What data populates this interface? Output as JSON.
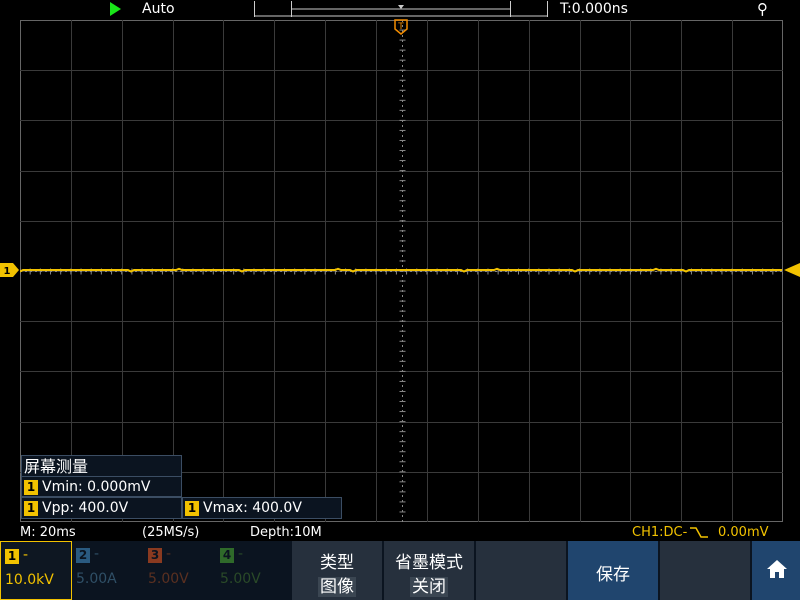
{
  "topbar": {
    "trigger_mode": "Auto",
    "trigger_time": "T:0.000ns"
  },
  "screen_measure": {
    "title": "屏幕测量",
    "vmin": "Vmin: 0.000mV",
    "vpp": "Vpp: 400.0V",
    "vmax": "Vmax: 400.0V",
    "channel": "1"
  },
  "status": {
    "timebase": "M: 20ms",
    "sample_rate": "(25MS/s)",
    "depth": "Depth:10M",
    "ch1_coupling": "CH1:DC-",
    "trigger_level": "0.00mV"
  },
  "channels": [
    {
      "num": "1",
      "dash": "-",
      "scale": "10.0kV",
      "color": "#f2c200"
    },
    {
      "num": "2",
      "dash": "-",
      "scale": "5.00A",
      "color": "#2a5a80"
    },
    {
      "num": "3",
      "dash": "-",
      "scale": "5.00V",
      "color": "#8a3a20"
    },
    {
      "num": "4",
      "dash": "-",
      "scale": "5.00V",
      "color": "#2f6a2a"
    }
  ],
  "softkeys": {
    "type_label": "类型",
    "type_value": "图像",
    "ink_label": "省墨模式",
    "ink_value": "关闭",
    "save_label": "保存"
  },
  "markers": {
    "trigger_marker": "T",
    "ch1_marker": "1"
  },
  "colors": {
    "ch1": "#f2c200",
    "run": "#19e619",
    "accent": "#20456e"
  }
}
